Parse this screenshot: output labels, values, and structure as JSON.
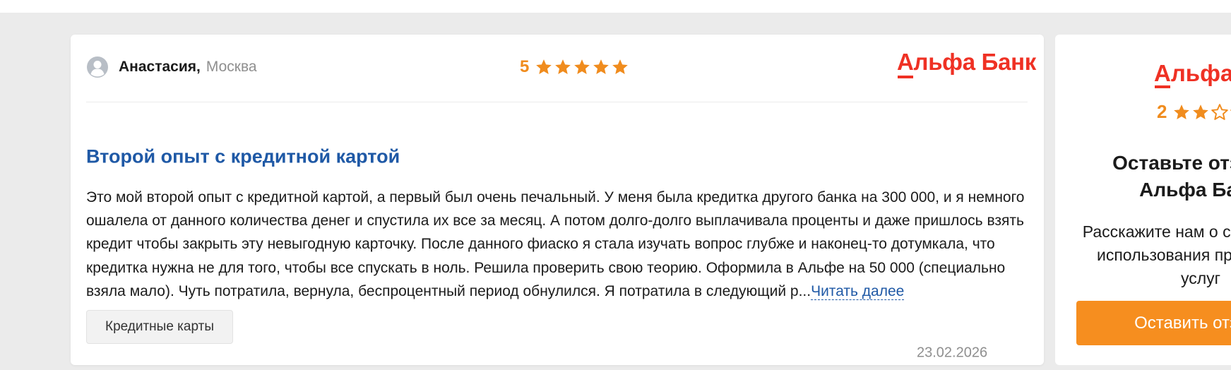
{
  "colors": {
    "accent_orange": "#f08c1e",
    "bank_red": "#ef3124",
    "title_blue": "#1f59a6",
    "muted_gray": "#8f8f8f",
    "page_background": "#ebebeb"
  },
  "review": {
    "author": {
      "name": "Анастасия,",
      "city": "Москва",
      "avatar_icon": "user-avatar-icon"
    },
    "rating": {
      "value": "5",
      "max": 5,
      "filled_stars": 5,
      "icon": "star-icon"
    },
    "bank_name": "Альфа Банк",
    "title": "Второй опыт с кредитной картой",
    "text": "Это мой второй опыт с кредитной картой, а первый был очень печальный. У меня была кредитка другого банка на 300 000, и я немного ошалела от данного количества денег и спустила их все за месяц. А потом долго-долго выплачивала проценты и даже пришлось взять кредит чтобы закрыть эту невыгодную карточку. После данного фиаско я стала изучать вопрос глубже и наконец-то дотумкала, что кредитка нужна не для того, чтобы все спускать в ноль. Решила проверить свою теорию. Оформила в Альфе на 50 000 (специально взяла мало). Чуть потратила, вернула, беспроцентный период обнулился. Я потратила в следующий р...",
    "read_more": "Читать далее",
    "tag": "Кредитные карты",
    "date": "23.02.2026"
  },
  "sidebar_card": {
    "bank_name": "Альфа Банк",
    "rating": {
      "value": "2",
      "max": 5,
      "filled_stars": 2,
      "icon": "star-icon"
    },
    "heading": "Оставьте отзыв о Альфа Банк",
    "description": "Расскажите нам о своем опыте использования продуктов и услуг",
    "button_label": "Оставить отзыв"
  }
}
